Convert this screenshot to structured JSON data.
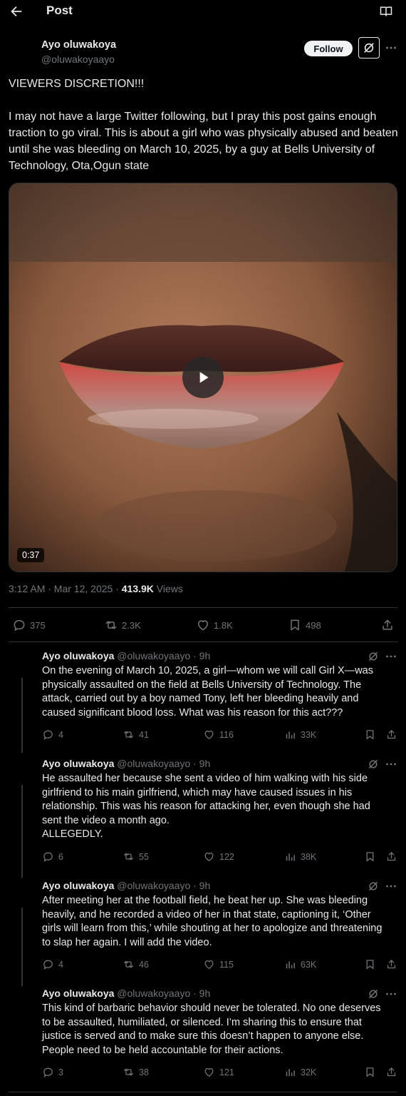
{
  "header": {
    "title": "Post"
  },
  "post": {
    "author_name": "Ayo oluwakoya",
    "author_handle": "@oluwakoyaayo",
    "follow_label": "Follow",
    "text_line1": "VIEWERS DISCRETION!!!",
    "text_para2": "I may not have a large Twitter following, but I pray this post gains enough traction to go viral. This is about a girl who was physically abused and beaten until she was bleeding on March 10, 2025, by a guy at Bells University of Technology, Ota,Ogun state",
    "video_duration": "0:37",
    "time": "3:12 AM · Mar 12, 2025 · ",
    "views_count": "413.9K",
    "views_label": " Views",
    "stats": {
      "replies": "375",
      "reposts": "2.3K",
      "likes": "1.8K",
      "bookmarks": "498"
    }
  },
  "replies": [
    {
      "name": "Ayo oluwakoya",
      "meta": " @oluwakoyaayo · 9h",
      "lines": [
        "On the evening of March 10, 2025, a girl—whom we will call Girl X—was",
        "physically assaulted on the field at Bells University of Technology. The",
        "attack, carried out by a boy named Tony, left her bleeding heavily and",
        "caused significant blood loss. What was his reason for this act???"
      ],
      "stats": {
        "replies": "4",
        "reposts": "41",
        "likes": "116",
        "views": "33K"
      }
    },
    {
      "name": "Ayo oluwakoya",
      "meta": " @oluwakoyaayo · 9h",
      "lines": [
        "He assaulted her because she sent a video of him walking with his side",
        "girlfriend to his main girlfriend, which may have caused issues in his",
        "relationship. This was his reason for attacking her, even though she had",
        "sent the video a month ago.",
        "ALLEGEDLY."
      ],
      "stats": {
        "replies": "6",
        "reposts": "55",
        "likes": "122",
        "views": "38K"
      }
    },
    {
      "name": "Ayo oluwakoya",
      "meta": " @oluwakoyaayo · 9h",
      "lines": [
        "After meeting her at the football field, he beat her up. She was bleeding",
        "heavily, and he recorded a video of her in that state, captioning it, ‘Other",
        "girls will learn from this,’ while shouting at her to apologize and threatening",
        "to slap her again. I will add the video."
      ],
      "stats": {
        "replies": "4",
        "reposts": "46",
        "likes": "115",
        "views": "63K"
      }
    },
    {
      "name": "Ayo oluwakoya",
      "meta": " @oluwakoyaayo · 9h",
      "lines": [
        "This kind of barbaric behavior should never be tolerated. No one deserves",
        "to be assaulted, humiliated, or silenced. I’m sharing this to ensure that",
        "justice is served and to make sure this doesn’t happen to anyone else.",
        "People need to be held accountable for their actions."
      ],
      "stats": {
        "replies": "3",
        "reposts": "38",
        "likes": "121",
        "views": "32K"
      }
    }
  ]
}
